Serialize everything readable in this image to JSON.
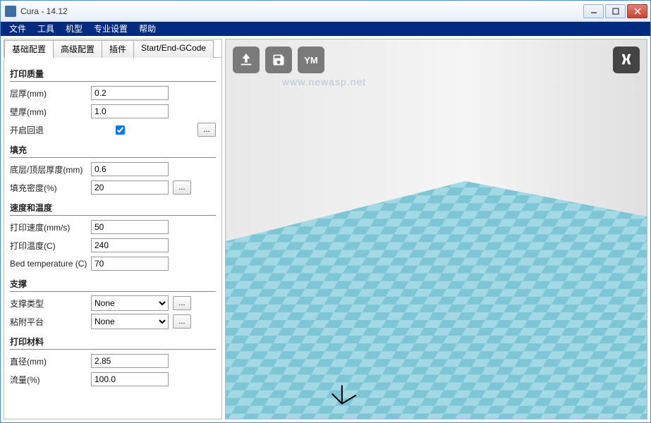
{
  "window": {
    "title": "Cura - 14.12"
  },
  "menu": [
    "文件",
    "工具",
    "机型",
    "专业设置",
    "帮助"
  ],
  "tabs": [
    "基础配置",
    "高级配置",
    "插件",
    "Start/End-GCode"
  ],
  "sections": {
    "print_quality": {
      "title": "打印质量",
      "layer_height": {
        "label": "层厚(mm)",
        "value": "0.2"
      },
      "wall_thickness": {
        "label": "壁厚(mm)",
        "value": "1.0"
      },
      "retraction": {
        "label": "开启回退",
        "checked": true
      }
    },
    "fill": {
      "title": "填充",
      "bottom_top": {
        "label": "底层/顶层厚度(mm)",
        "value": "0.6"
      },
      "density": {
        "label": "填充密度(%)",
        "value": "20"
      }
    },
    "speed_temp": {
      "title": "速度和温度",
      "print_speed": {
        "label": "打印速度(mm/s)",
        "value": "50"
      },
      "print_temp": {
        "label": "打印温度(C)",
        "value": "240"
      },
      "bed_temp": {
        "label": "Bed temperature (C)",
        "value": "70"
      }
    },
    "support": {
      "title": "支撑",
      "support_type": {
        "label": "支撑类型",
        "value": "None"
      },
      "adhesion": {
        "label": "粘附平台",
        "value": "None"
      }
    },
    "material": {
      "title": "打印材料",
      "diameter": {
        "label": "直径(mm)",
        "value": "2.85"
      },
      "flow": {
        "label": "流量(%)",
        "value": "100.0"
      }
    }
  },
  "toolbar_icons": {
    "load": "load-model-icon",
    "save": "save-icon",
    "share": "YM",
    "view": "view-mode-icon"
  },
  "watermark": "www.newasp.net",
  "ellipsis": "..."
}
